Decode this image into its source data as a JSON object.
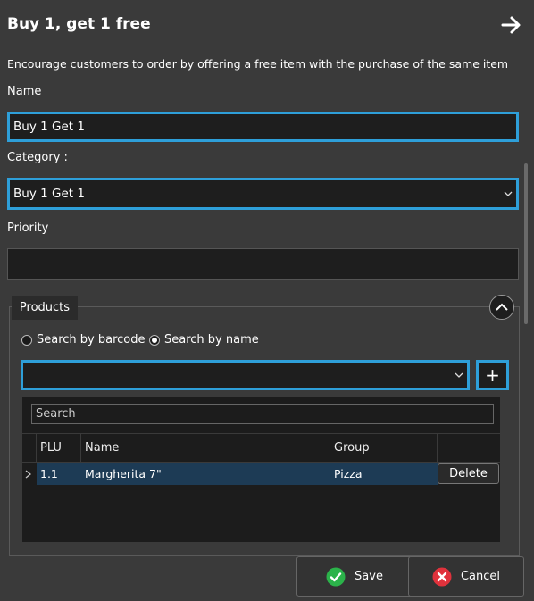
{
  "dialog": {
    "title": "Buy 1, get 1 free",
    "description": "Encourage customers to order by offering a free item with the purchase of the same item"
  },
  "name": {
    "label": "Name",
    "value": "Buy 1 Get 1"
  },
  "category": {
    "label": "Category :",
    "value": "Buy 1 Get 1"
  },
  "priority": {
    "label": "Priority",
    "value": ""
  },
  "products": {
    "tab_label": "Products",
    "radio_barcode": "Search by barcode",
    "radio_name": "Search by name",
    "selected_radio": "name",
    "add_label": "+",
    "search_placeholder": "Search",
    "columns": [
      "PLU",
      "Name",
      "Group"
    ],
    "rows": [
      {
        "plu": "1.1",
        "name": "Margherita 7\"",
        "group": "Pizza",
        "action": "Delete"
      }
    ]
  },
  "footer": {
    "save_label": "Save",
    "cancel_label": "Cancel"
  },
  "colors": {
    "accent": "#2e9fd9",
    "background": "#3a3a3a",
    "field": "#1e1e1e",
    "save_icon": "#2bb34a",
    "cancel_icon": "#e0323c"
  },
  "icons": {
    "header": "arrow-right-icon",
    "collapse": "chevron-up-icon",
    "save": "check-circle-icon",
    "cancel": "close-circle-icon"
  }
}
